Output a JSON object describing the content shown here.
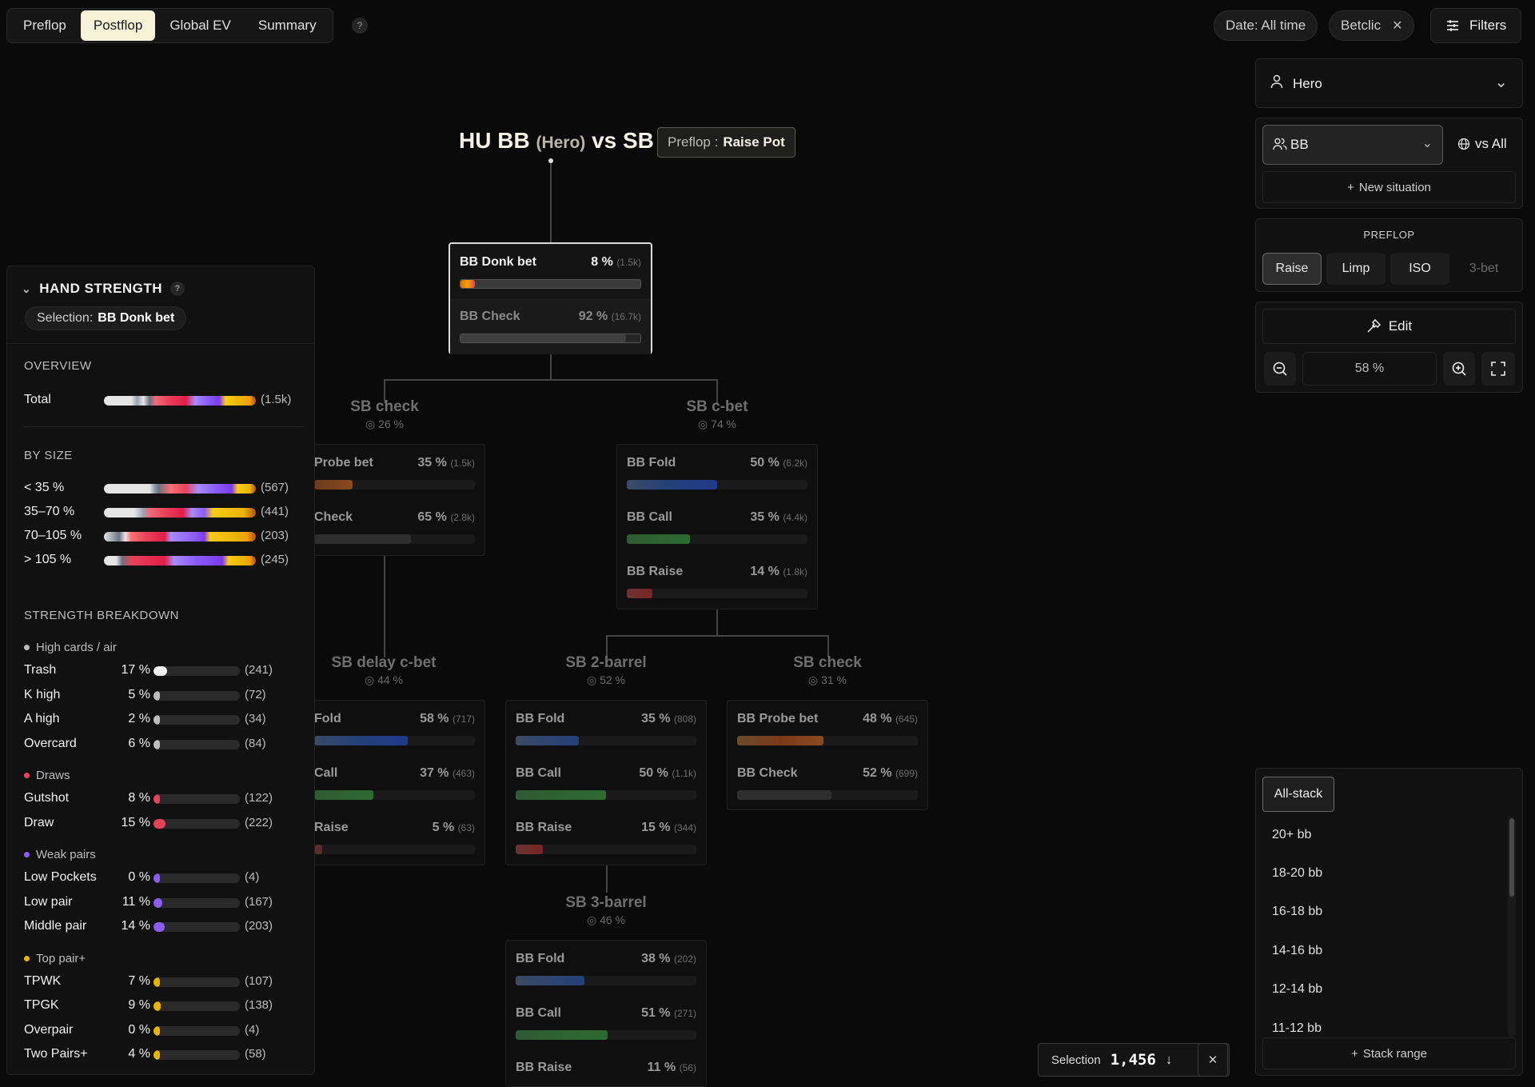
{
  "nav": {
    "tabs": [
      "Preflop",
      "Postflop",
      "Global EV",
      "Summary"
    ],
    "active_tab": "Postflop",
    "help": "?",
    "date_filter": "Date: All time",
    "site_filter": "Betclic",
    "filters_label": "Filters"
  },
  "tree": {
    "title_main": "HU BB",
    "title_hero": "(Hero)",
    "title_vs": "vs SB",
    "preflop_label": "Preflop :",
    "preflop_value": "Raise Pot",
    "root": [
      {
        "label": "BB Donk bet",
        "pct": "8 %",
        "count": "(1.5k)"
      },
      {
        "label": "BB Check",
        "pct": "92 %",
        "count": "(16.7k)"
      }
    ],
    "groups": [
      {
        "title": "SB check",
        "sub": "26 %",
        "rows": [
          {
            "label": "Probe bet",
            "pct": "35 %",
            "count": "(1.5k)"
          },
          {
            "label": "Check",
            "pct": "65 %",
            "count": "(2.8k)"
          }
        ]
      },
      {
        "title": "SB c-bet",
        "sub": "74 %",
        "rows": [
          {
            "label": "BB Fold",
            "pct": "50 %",
            "count": "(6.2k)"
          },
          {
            "label": "BB Call",
            "pct": "35 %",
            "count": "(4.4k)"
          },
          {
            "label": "BB Raise",
            "pct": "14 %",
            "count": "(1.8k)"
          }
        ]
      },
      {
        "title": "SB delay c-bet",
        "sub": "44 %",
        "rows": [
          {
            "label": "Fold",
            "pct": "58 %",
            "count": "(717)"
          },
          {
            "label": "Call",
            "pct": "37 %",
            "count": "(463)"
          },
          {
            "label": "Raise",
            "pct": "5 %",
            "count": "(63)"
          }
        ]
      },
      {
        "title": "SB 2-barrel",
        "sub": "52 %",
        "rows": [
          {
            "label": "BB Fold",
            "pct": "35 %",
            "count": "(808)"
          },
          {
            "label": "BB Call",
            "pct": "50 %",
            "count": "(1.1k)"
          },
          {
            "label": "BB Raise",
            "pct": "15 %",
            "count": "(344)"
          }
        ]
      },
      {
        "title": "SB check",
        "sub": "31 %",
        "rows": [
          {
            "label": "BB Probe bet",
            "pct": "48 %",
            "count": "(645)"
          },
          {
            "label": "BB Check",
            "pct": "52 %",
            "count": "(699)"
          }
        ]
      },
      {
        "title": "SB 3-barrel",
        "sub": "46 %",
        "rows": [
          {
            "label": "BB Fold",
            "pct": "38 %",
            "count": "(202)"
          },
          {
            "label": "BB Call",
            "pct": "51 %",
            "count": "(271)"
          },
          {
            "label": "BB Raise",
            "pct": "11 %",
            "count": "(56)"
          }
        ]
      }
    ]
  },
  "hand_strength": {
    "title": "HAND STRENGTH",
    "help": "?",
    "selection_label": "Selection:",
    "selection_value": "BB Donk bet",
    "overview_title": "OVERVIEW",
    "total_label": "Total",
    "total_count": "(1.5k)",
    "by_size_title": "BY SIZE",
    "sizes": [
      {
        "label": "< 35 %",
        "count": "(567)"
      },
      {
        "label": "35–70 %",
        "count": "(441)"
      },
      {
        "label": "70–105 %",
        "count": "(203)"
      },
      {
        "label": "> 105 %",
        "count": "(245)"
      }
    ],
    "breakdown_title": "STRENGTH BREAKDOWN",
    "categories": [
      {
        "name": "High cards / air",
        "color": "#bdbdbd",
        "items": [
          {
            "label": "Trash",
            "pct": "17 %",
            "count": "(241)",
            "value": 17
          },
          {
            "label": "K high",
            "pct": "5 %",
            "count": "(72)",
            "value": 5
          },
          {
            "label": "A high",
            "pct": "2 %",
            "count": "(34)",
            "value": 2
          },
          {
            "label": "Overcard",
            "pct": "6 %",
            "count": "(84)",
            "value": 6
          }
        ]
      },
      {
        "name": "Draws",
        "color": "#e8435a",
        "items": [
          {
            "label": "Gutshot",
            "pct": "8 %",
            "count": "(122)",
            "value": 8
          },
          {
            "label": "Draw",
            "pct": "15 %",
            "count": "(222)",
            "value": 15
          }
        ]
      },
      {
        "name": "Weak pairs",
        "color": "#8b5cf6",
        "items": [
          {
            "label": "Low Pockets",
            "pct": "0 %",
            "count": "(4)",
            "value": 0
          },
          {
            "label": "Low pair",
            "pct": "11 %",
            "count": "(167)",
            "value": 11
          },
          {
            "label": "Middle pair",
            "pct": "14 %",
            "count": "(203)",
            "value": 14
          }
        ]
      },
      {
        "name": "Top pair+",
        "color": "#eab308",
        "items": [
          {
            "label": "TPWK",
            "pct": "7 %",
            "count": "(107)",
            "value": 7
          },
          {
            "label": "TPGK",
            "pct": "9 %",
            "count": "(138)",
            "value": 9
          },
          {
            "label": "Overpair",
            "pct": "0 %",
            "count": "(4)",
            "value": 0
          },
          {
            "label": "Two Pairs+",
            "pct": "4 %",
            "count": "(58)",
            "value": 4
          }
        ]
      }
    ]
  },
  "right": {
    "player": "Hero",
    "position": "BB",
    "vs": "vs All",
    "new_situation": "New situation",
    "preflop_title": "PREFLOP",
    "preflop_actions": [
      "Raise",
      "Limp",
      "ISO",
      "3-bet"
    ],
    "preflop_active": "Raise",
    "edit": "Edit",
    "zoom": "58 %",
    "stacks": [
      "All-stack",
      "20+ bb",
      "18-20 bb",
      "16-18 bb",
      "14-16 bb",
      "12-14 bb",
      "11-12 bb"
    ],
    "stack_range": "Stack range"
  },
  "selection": {
    "label": "Selection",
    "value": "1,456"
  }
}
